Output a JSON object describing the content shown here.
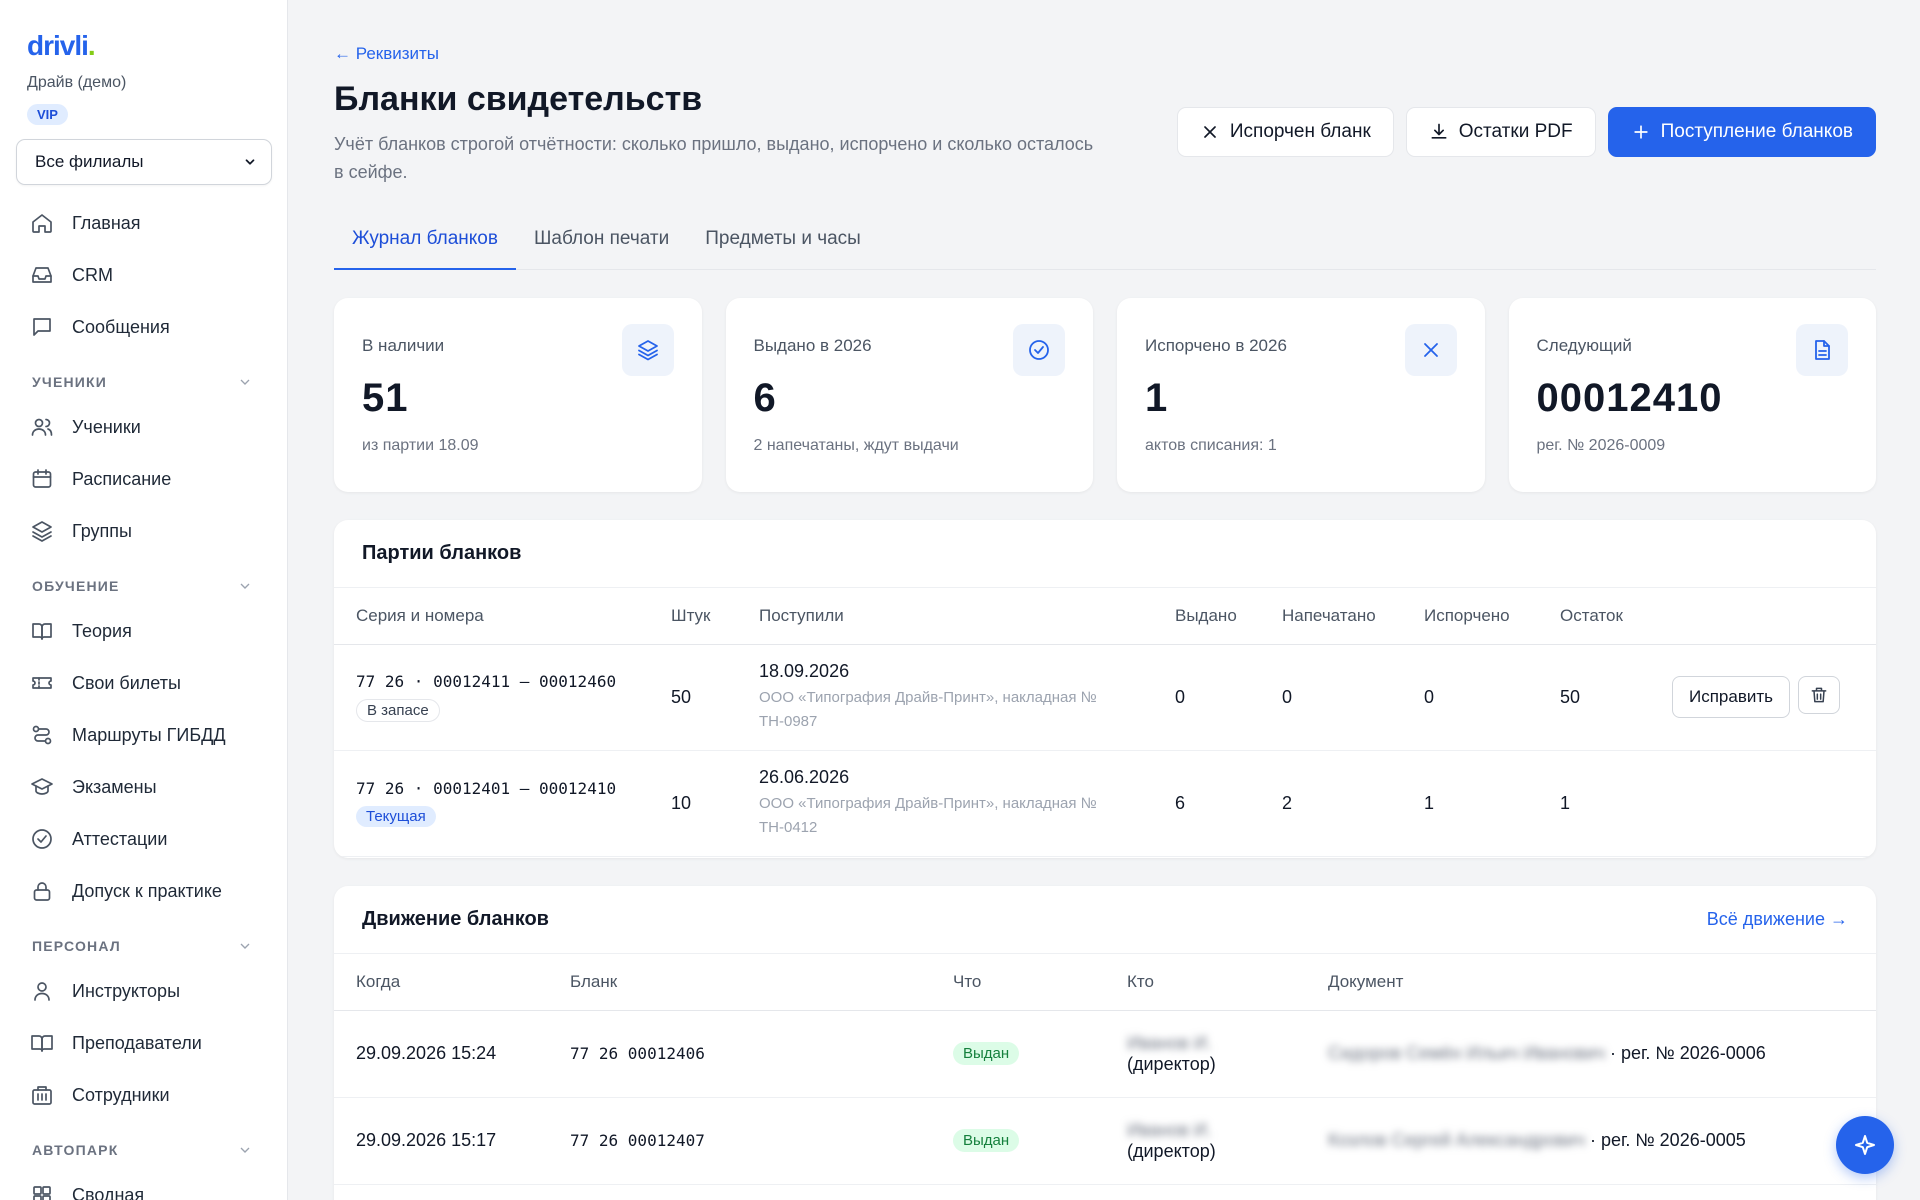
{
  "sidebar": {
    "logo_text": "drivli",
    "logo_dot": ".",
    "org_name": "Драйв (демо)",
    "plan_badge": "VIP",
    "branch_select": "Все филиалы",
    "top_items": [
      {
        "label": "Главная",
        "icon": "home-icon"
      },
      {
        "label": "CRM",
        "icon": "inbox-icon"
      },
      {
        "label": "Сообщения",
        "icon": "message-icon"
      }
    ],
    "sections": [
      {
        "title": "УЧЕНИКИ",
        "items": [
          {
            "label": "Ученики",
            "icon": "users-icon"
          },
          {
            "label": "Расписание",
            "icon": "calendar-icon"
          },
          {
            "label": "Группы",
            "icon": "layers-icon"
          }
        ]
      },
      {
        "title": "ОБУЧЕНИЕ",
        "items": [
          {
            "label": "Теория",
            "icon": "book-icon"
          },
          {
            "label": "Свои билеты",
            "icon": "ticket-icon"
          },
          {
            "label": "Маршруты ГИБДД",
            "icon": "route-icon"
          },
          {
            "label": "Экзамены",
            "icon": "graduation-icon"
          },
          {
            "label": "Аттестации",
            "icon": "check-circle-icon"
          },
          {
            "label": "Допуск к практике",
            "icon": "lock-icon"
          }
        ]
      },
      {
        "title": "ПЕРСОНАЛ",
        "items": [
          {
            "label": "Инструкторы",
            "icon": "user-icon"
          },
          {
            "label": "Преподаватели",
            "icon": "book-open-icon"
          },
          {
            "label": "Сотрудники",
            "icon": "building-icon"
          }
        ]
      },
      {
        "title": "АВТОПАРК",
        "items": [
          {
            "label": "Сводная",
            "icon": "grid-icon"
          }
        ]
      }
    ]
  },
  "header": {
    "back_link": "← Реквизиты",
    "title": "Бланки свидетельств",
    "description": "Учёт бланков строгой отчётности: сколько пришло, выдано, испорчено и сколько осталось в сейфе.",
    "actions": {
      "spoiled": "Испорчен бланк",
      "remainders_pdf": "Остатки PDF",
      "receipt": "Поступление бланков"
    }
  },
  "tabs": [
    {
      "label": "Журнал бланков",
      "active": true
    },
    {
      "label": "Шаблон печати",
      "active": false
    },
    {
      "label": "Предметы и часы",
      "active": false
    }
  ],
  "stats": [
    {
      "label": "В наличии",
      "value": "51",
      "sub": "из партии 18.09",
      "icon": "layers-icon"
    },
    {
      "label": "Выдано в 2026",
      "value": "6",
      "sub": "2 напечатаны, ждут выдачи",
      "icon": "check-circle-icon"
    },
    {
      "label": "Испорчено в 2026",
      "value": "1",
      "sub": "актов списания: 1",
      "icon": "close-icon"
    },
    {
      "label": "Следующий",
      "value": "00012410",
      "sub": "рег. № 2026-0009",
      "icon": "document-icon"
    }
  ],
  "batches": {
    "title": "Партии бланков",
    "columns": [
      "Серия и номера",
      "Штук",
      "Поступили",
      "Выдано",
      "Напечатано",
      "Испорчено",
      "Остаток"
    ],
    "rows": [
      {
        "range": "77 26 · 00012411 — 00012460",
        "badge": "В запасе",
        "badge_type": "reserve",
        "count": "50",
        "date": "18.09.2026",
        "supplier": "ООО «Типография Драйв-Принт», накладная № ТН-0987",
        "issued": "0",
        "printed": "0",
        "spoiled": "0",
        "remainder": "50",
        "fix_label": "Исправить"
      },
      {
        "range": "77 26 · 00012401 — 00012410",
        "badge": "Текущая",
        "badge_type": "current",
        "count": "10",
        "date": "26.06.2026",
        "supplier": "ООО «Типография Драйв-Принт», накладная № ТН-0412",
        "issued": "6",
        "printed": "2",
        "spoiled": "1",
        "remainder": "1"
      }
    ]
  },
  "movements": {
    "title": "Движение бланков",
    "all_link": "Всё движение →",
    "columns": [
      "Когда",
      "Бланк",
      "Что",
      "Кто",
      "Документ"
    ],
    "rows": [
      {
        "when": "29.09.2026 15:24",
        "blank": "77 26 00012406",
        "what": "Выдан",
        "who_name": "Иванов И.",
        "who_role": "(директор)",
        "doc_name": "Сидоров Семён Ильич Иванович",
        "doc_reg": "· рег. № 2026-0006"
      },
      {
        "when": "29.09.2026 15:17",
        "blank": "77 26 00012407",
        "what": "Выдан",
        "who_name": "Иванов И.",
        "who_role": "(директор)",
        "doc_name": "Козлов Сергей Александрович",
        "doc_reg": "· рег. № 2026-0005"
      }
    ]
  },
  "colors": {
    "accent": "#2563eb",
    "success": "#15803d",
    "logo_dot": "#84cc16"
  }
}
